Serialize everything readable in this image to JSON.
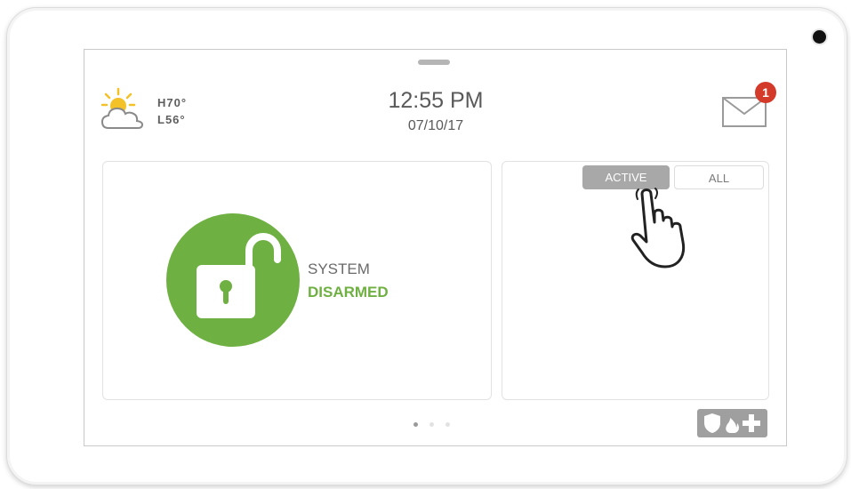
{
  "weather": {
    "icon": "partly-cloudy-icon",
    "high": "H70°",
    "low": "L56°"
  },
  "clock": {
    "time": "12:55 PM",
    "date": "07/10/17"
  },
  "messages": {
    "icon": "envelope-icon",
    "unread_count": "1"
  },
  "security": {
    "icon": "unlocked-padlock-icon",
    "label": "SYSTEM",
    "state": "DISARMED"
  },
  "sensors": {
    "tabs": [
      {
        "label": "ACTIVE",
        "selected": true
      },
      {
        "label": "ALL",
        "selected": false
      }
    ]
  },
  "pager": {
    "pages": 3,
    "current_page": 1
  },
  "emergency": {
    "icons": [
      "shield-icon",
      "fire-icon",
      "medical-cross-icon"
    ]
  },
  "colors": {
    "armed_state_green": "#6fb042",
    "badge_red": "#d43a2a",
    "active_tab_gray": "#a8a8a8"
  }
}
